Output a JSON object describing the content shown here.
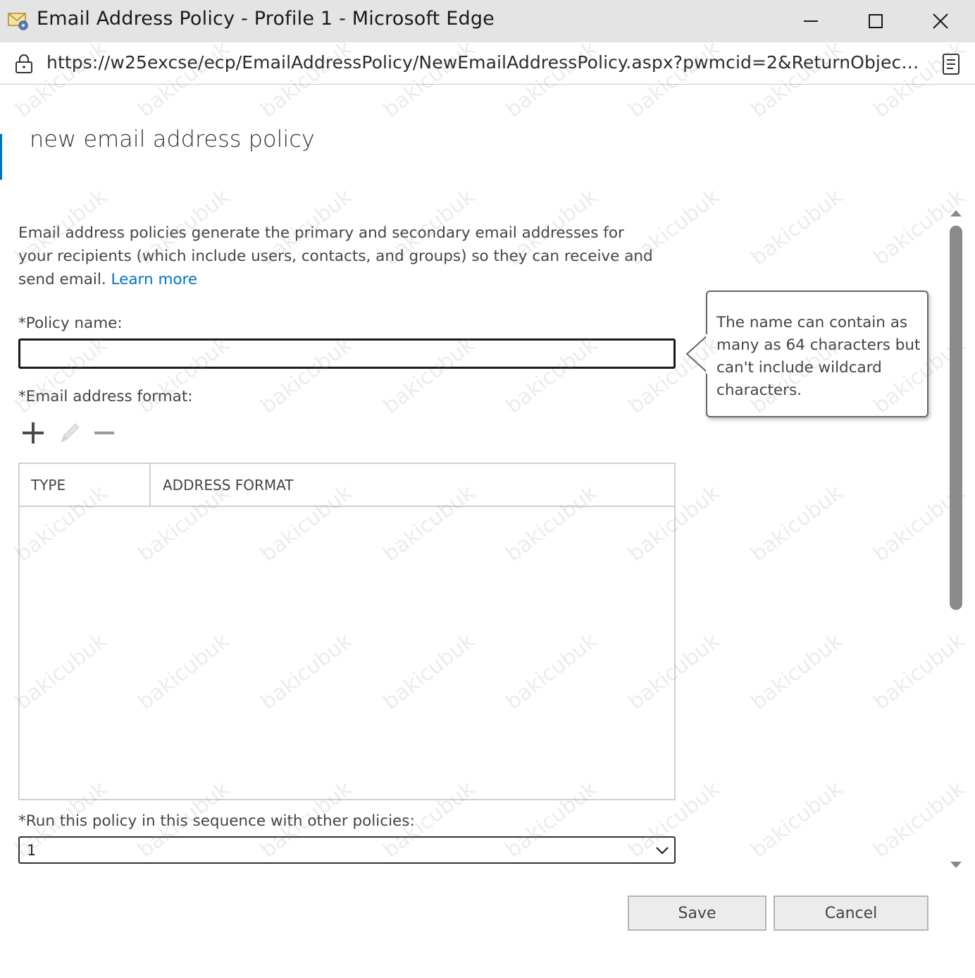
{
  "window": {
    "title": "Email Address Policy - Profile 1 - Microsoft Edge",
    "app_icon": "email-policy-app-icon"
  },
  "address_bar": {
    "url": "https://w25excse/ecp/EmailAddressPolicy/NewEmailAddressPolicy.aspx?pwmcid=2&ReturnObjectT…"
  },
  "page": {
    "title": "new email address policy",
    "intro": "Email address policies generate the primary and secondary email addresses for your recipients (which include users, contacts, and groups) so they can receive and send email.",
    "learn_more": "Learn more"
  },
  "form": {
    "policy_name_label": "*Policy name:",
    "policy_name_value": "",
    "email_format_label": "*Email address format:",
    "toolbar": {
      "add_icon": "plus-icon",
      "edit_icon": "pencil-icon",
      "remove_icon": "minus-icon"
    },
    "grid": {
      "columns": [
        "TYPE",
        "ADDRESS FORMAT"
      ],
      "rows": []
    },
    "sequence_label": "*Run this policy in this sequence with other policies:",
    "sequence_value": "1"
  },
  "callout": {
    "text": "The name can contain as many as 64 characters but can't include wildcard characters."
  },
  "buttons": {
    "save": "Save",
    "cancel": "Cancel"
  },
  "watermark": "bakicubuk"
}
